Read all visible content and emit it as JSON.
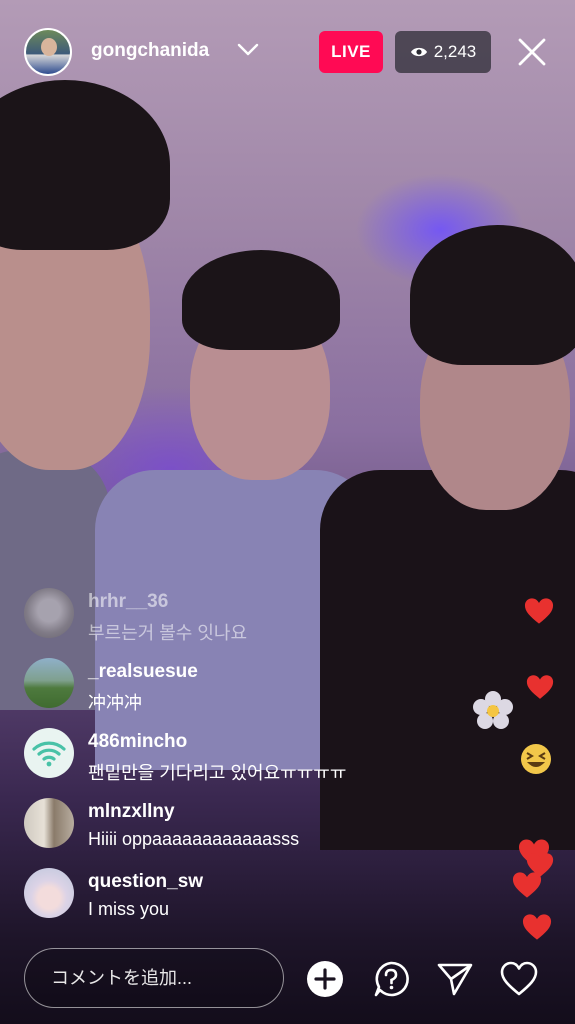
{
  "host": {
    "username": "gongchanida",
    "live_label": "LIVE",
    "viewer_count": "2,243",
    "icons": {
      "chevron": "chevron-down-icon",
      "viewers": "eye-icon",
      "close": "close-icon"
    }
  },
  "comments": [
    {
      "username": "hrhr__36",
      "text": "부르는거 볼수 잇나요",
      "faded": true
    },
    {
      "username": "_realsuesue",
      "text": "冲冲冲"
    },
    {
      "username": "486mincho",
      "text": "팬밑만을 기다리고 있어요ㅠㅠㅠㅠ"
    },
    {
      "username": "mlnzxllny",
      "text": "Hiiii oppaaaaaaaaaaaasss"
    },
    {
      "username": "question_sw",
      "text": "I miss you"
    }
  ],
  "bottom_bar": {
    "comment_placeholder": "コメントを追加...",
    "icons": [
      "add-circle-icon",
      "question-icon",
      "send-icon",
      "heart-icon"
    ]
  },
  "reactions": [
    "heart",
    "heart",
    "flower",
    "grin-squint-emoji",
    "heart",
    "heart",
    "heart",
    "heart"
  ],
  "colors": {
    "live_badge": "#ff0a54",
    "heart": "#e8312f"
  }
}
